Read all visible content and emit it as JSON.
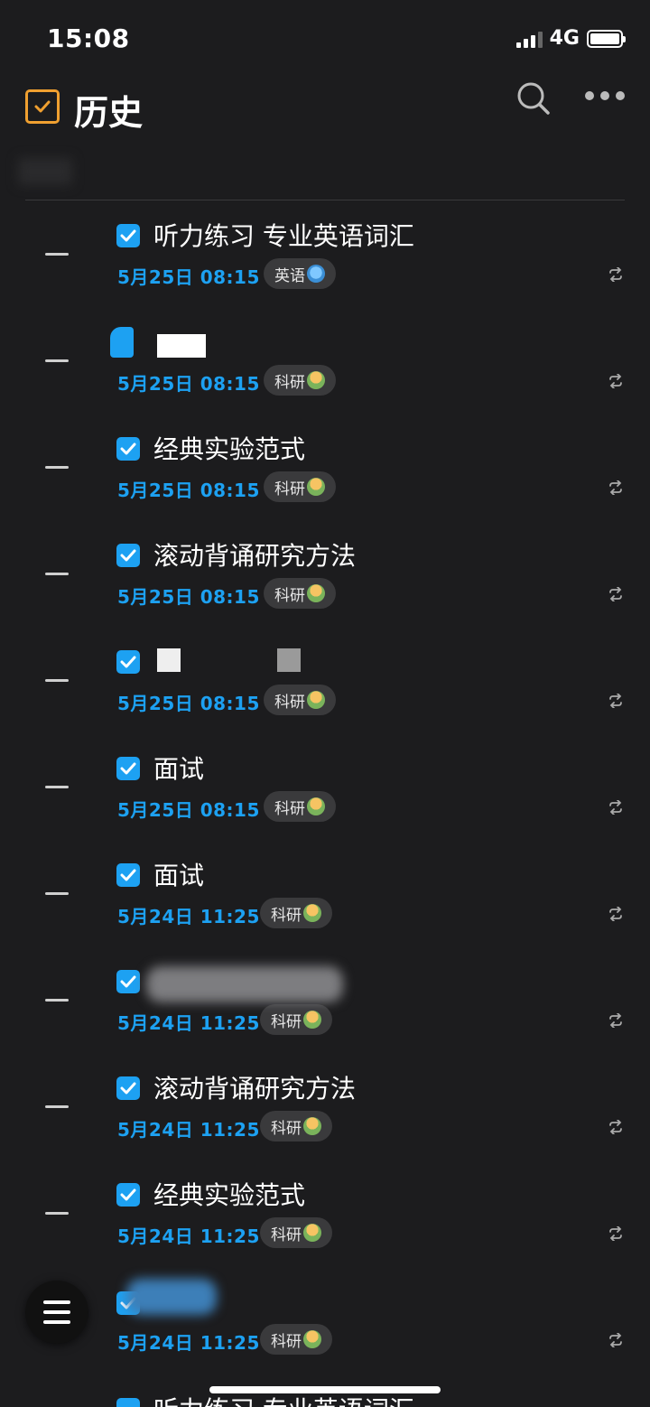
{
  "status_bar": {
    "time": "15:08",
    "network": "4G"
  },
  "header": {
    "title": "历史"
  },
  "items": [
    {
      "title": "听力练习 专业英语词汇",
      "date": "5月25日 08:15",
      "tag": "英语"
    },
    {
      "title": "",
      "date": "5月25日 08:15",
      "tag": "科研"
    },
    {
      "title": "经典实验范式",
      "date": "5月25日 08:15",
      "tag": "科研"
    },
    {
      "title": "滚动背诵研究方法",
      "date": "5月25日 08:15",
      "tag": "科研"
    },
    {
      "title": "",
      "date": "5月25日 08:15",
      "tag": "科研"
    },
    {
      "title": "面试",
      "date": "5月25日 08:15",
      "tag": "科研"
    },
    {
      "title": "面试",
      "date": "5月24日 11:25",
      "tag": "科研"
    },
    {
      "title": "",
      "date": "5月24日 11:25",
      "tag": "科研"
    },
    {
      "title": "滚动背诵研究方法",
      "date": "5月24日 11:25",
      "tag": "科研"
    },
    {
      "title": "经典实验范式",
      "date": "5月24日 11:25",
      "tag": "科研"
    },
    {
      "title": "",
      "date": "5月24日 11:25",
      "tag": "科研"
    }
  ],
  "partial_item": {
    "title": "听力练习 专业英语词汇"
  },
  "colors": {
    "accent": "#1da1f2",
    "header_check": "#f0a030",
    "background": "#1c1c1e"
  },
  "icons": {
    "search": "search-icon",
    "more": "more-icon",
    "menu": "menu-icon",
    "repeat": "repeat-icon"
  }
}
